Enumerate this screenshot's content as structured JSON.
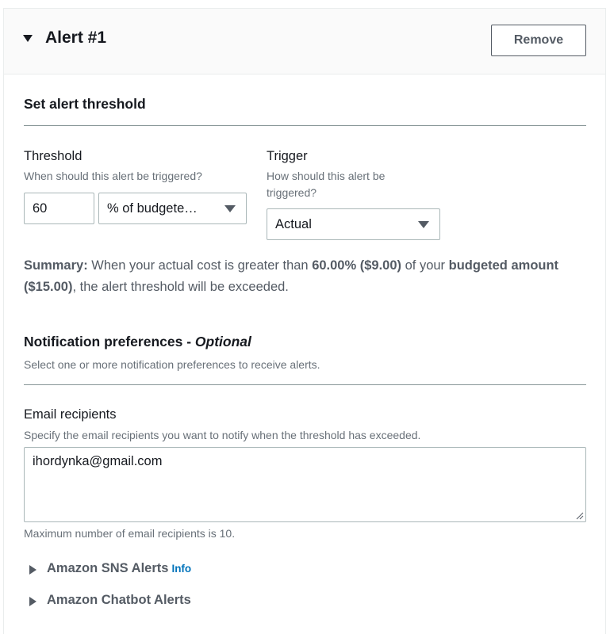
{
  "alert": {
    "title": "Alert #1",
    "remove_label": "Remove"
  },
  "threshold_section": {
    "title": "Set alert threshold",
    "threshold": {
      "label": "Threshold",
      "description": "When should this alert be triggered?",
      "value": "60",
      "unit_selected": "% of budgete…"
    },
    "trigger": {
      "label": "Trigger",
      "description": "How should this alert be triggered?",
      "selected": "Actual"
    },
    "summary": {
      "prefix": "Summary:",
      "part1": " When your actual cost is greater than ",
      "percent": "60.00% ($9.00)",
      "part2": " of your ",
      "budgeted": "budgeted amount ($15.00)",
      "part3": ", the alert threshold will be exceeded."
    }
  },
  "notification_section": {
    "title": "Notification preferences - ",
    "title_optional": "Optional",
    "description": "Select one or more notification preferences to receive alerts.",
    "email": {
      "label": "Email recipients",
      "description": "Specify the email recipients you want to notify when the threshold has exceeded.",
      "value": "ihordynka@gmail.com",
      "hint": "Maximum number of email recipients is 10."
    },
    "sns": {
      "label": "Amazon SNS Alerts",
      "info": "Info"
    },
    "chatbot": {
      "label": "Amazon Chatbot Alerts"
    }
  }
}
